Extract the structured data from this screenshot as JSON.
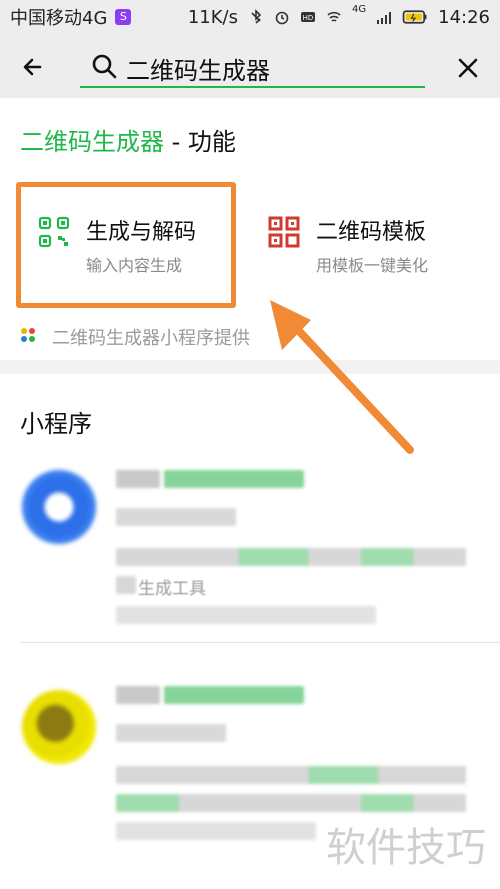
{
  "status": {
    "carrier": "中国移动4G",
    "sim_icon": "sim-badge",
    "speed": "11K/s",
    "time": "14:26",
    "network_label": "4G"
  },
  "search": {
    "query": "二维码生成器"
  },
  "feature_section": {
    "title_accent": "二维码生成器",
    "title_suffix": " - 功能",
    "items": [
      {
        "title": "生成与解码",
        "subtitle": "输入内容生成"
      },
      {
        "title": "二维码模板",
        "subtitle": "用模板一键美化"
      }
    ],
    "provider_text": "二维码生成器小程序提供"
  },
  "mini_programs": {
    "title": "小程序"
  },
  "blurred": {
    "line": "生成工具"
  },
  "watermark": "软件技巧",
  "colors": {
    "accent_green": "#20b84a",
    "highlight_orange": "#f08a34",
    "template_red": "#d23a2f",
    "scan_green": "#20b84a"
  }
}
